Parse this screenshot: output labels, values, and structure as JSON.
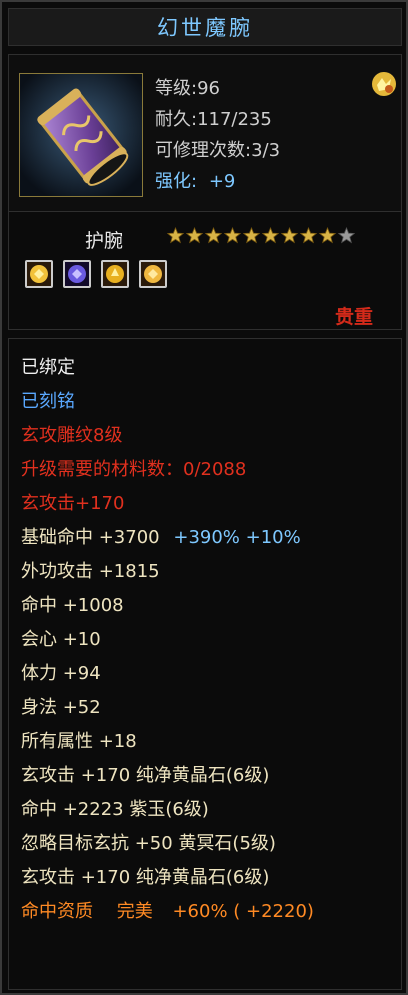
{
  "item": {
    "name": "幻世魔腕",
    "level": "等级:96",
    "durability": "耐久:117/235",
    "repair": "可修理次数:3/3",
    "enhance_label": "强化:",
    "enhance_value": "+9",
    "type": "护腕",
    "stars_filled": 9,
    "stars_total": 10,
    "rarity": "贵重"
  },
  "gem_icons": [
    "yellow-gem-icon",
    "purple-gem-icon",
    "yellow-gem-icon",
    "yellow-gem-icon"
  ],
  "details": {
    "bound": "已绑定",
    "engraved": "已刻铭",
    "carving": "玄攻雕纹8级",
    "upgrade_materials": "升级需要的材料数：0/2088",
    "carving_bonus": "玄攻击+170",
    "hit_base_label": "基础命中 +3700",
    "hit_base_extra": "+390% +10%",
    "ext_attack": "外功攻击 +1815",
    "hit": "命中 +1008",
    "crit": "会心 +10",
    "stamina": "体力 +94",
    "agility": "身法 +52",
    "all_attr": "所有属性 +18",
    "gem_line1": "玄攻击 +170 纯净黄晶石(6级)",
    "gem_line2": "命中 +2223 紫玉(6级)",
    "gem_line3": "忽略目标玄抗 +50 黄冥石(5级)",
    "gem_line4": "玄攻击 +170 纯净黄晶石(6级)",
    "aptitude_label": "命中资质",
    "aptitude_grade": "完美",
    "aptitude_value": "+60% ( +2220)"
  },
  "colors": {
    "title": "#7ec8ff",
    "rarity": "#d42a1a",
    "star_gold": "#d8b446",
    "star_empty": "#9a9a9a"
  }
}
